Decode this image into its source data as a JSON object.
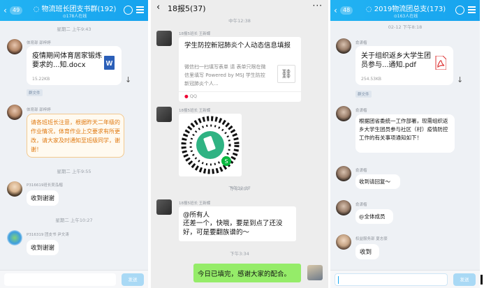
{
  "panel1": {
    "header": {
      "back_count": "49",
      "title": "物流班长团支书群(192)",
      "subtitle": "178人在线"
    },
    "time1": "星期二 上午9:43",
    "msg1": {
      "sender": "体育部 邵梓婷",
      "file_name": "疫情期间体育居家锻炼要求的...知.docx",
      "file_size": "15.22KB",
      "tag": "群文件"
    },
    "msg2": {
      "sender": "体育部 邵梓婷",
      "text": "请各班班长注意，根据昨天二年级的作业情况，体育作业上交要求有所更改，请大家及时通知至班级同学，谢谢！"
    },
    "time2": "星期二 上午9:55",
    "msg3": {
      "sender": "P316619班长吴泓楷",
      "text": "收到谢谢"
    },
    "time3": "星期二 上午10:27",
    "msg4": {
      "sender": "P316319 团支书 尹文涛",
      "text": "收到谢谢"
    },
    "send_label": "发送"
  },
  "panel2": {
    "header": {
      "title": "18报5(37)"
    },
    "time1": "中午12:38",
    "msg1": {
      "sender": "18报5班长 王新蝶",
      "title": "学生防控新冠肺炎个人动态信息填报",
      "desc": "微信扫一扫填写表单 请 表单只限在微信里填写 Powered by MSJ 学生防控新冠肺炎个人...",
      "source": "QQ"
    },
    "msg2": {
      "sender": "18报5班长 王新蝶"
    },
    "time2": "下午12:37",
    "time3": "下午3:07",
    "msg3": {
      "sender": "18报5班长 王新蝶",
      "line1": "@所有人",
      "line2": "还差一个，快哦，要是到点了还没好，可是要翻族谱的～"
    },
    "time4": "下午3:34",
    "msg4": {
      "text": "今日已填完，感谢大家的配合。"
    }
  },
  "panel3": {
    "header": {
      "back_count": "48",
      "title": "2019物流团总支(173)",
      "subtitle": "163人在线"
    },
    "time1": "02-12 下午8:18",
    "msg1": {
      "sender": "俞潇楷",
      "file_name": "关于组织返乡大学生团员参与...通知.pdf",
      "file_size": "254.53KB",
      "tag": "群文件"
    },
    "msg2": {
      "sender": "俞潇楷",
      "text": "根据团省委统一工作部署，现需组织返乡大学生团员参与社区（村）疫情防控工作的有关事项通知如下！"
    },
    "msg3": {
      "sender": "俞潇楷",
      "text": "收到请回复～"
    },
    "msg4": {
      "sender": "俞潇楷",
      "text": "@全体成员"
    },
    "msg5": {
      "sender": "权益服务部 夏志豪",
      "text": "收到"
    },
    "send_label": "发送"
  },
  "colors": {
    "qq_blue": "#1aa8f0",
    "wechat_green": "#95ec69",
    "notice_orange": "#e07a12"
  }
}
